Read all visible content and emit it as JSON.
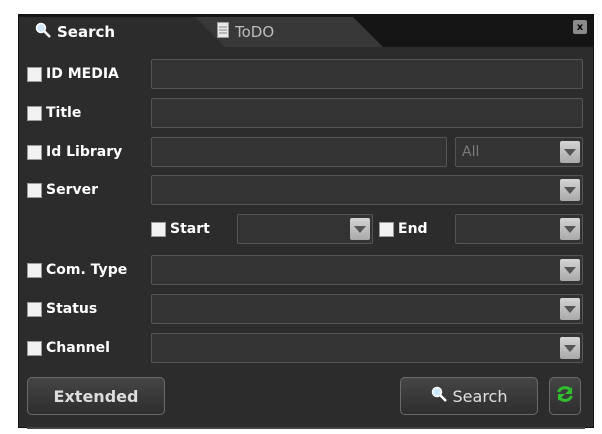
{
  "tabs": [
    {
      "label": "Search",
      "icon": "magnifier-icon"
    },
    {
      "label": "ToDO",
      "icon": "document-icon"
    }
  ],
  "close_label": "x",
  "fields": {
    "id_media": {
      "label": "ID MEDIA",
      "value": ""
    },
    "title": {
      "label": "Title",
      "value": ""
    },
    "id_library": {
      "label": "Id Library",
      "value": "",
      "select_value": "All"
    },
    "server": {
      "label": "Server",
      "value": ""
    },
    "start": {
      "label": "Start",
      "value": ""
    },
    "end": {
      "label": "End",
      "value": ""
    },
    "com_type": {
      "label": "Com. Type",
      "value": ""
    },
    "status": {
      "label": "Status",
      "value": ""
    },
    "channel": {
      "label": "Channel",
      "value": ""
    }
  },
  "buttons": {
    "extended": "Extended",
    "search": "Search"
  },
  "colors": {
    "panel_bg": "#2c2c2c",
    "tabbar_bg": "#151515",
    "refresh_green": "#2fbf2f"
  }
}
